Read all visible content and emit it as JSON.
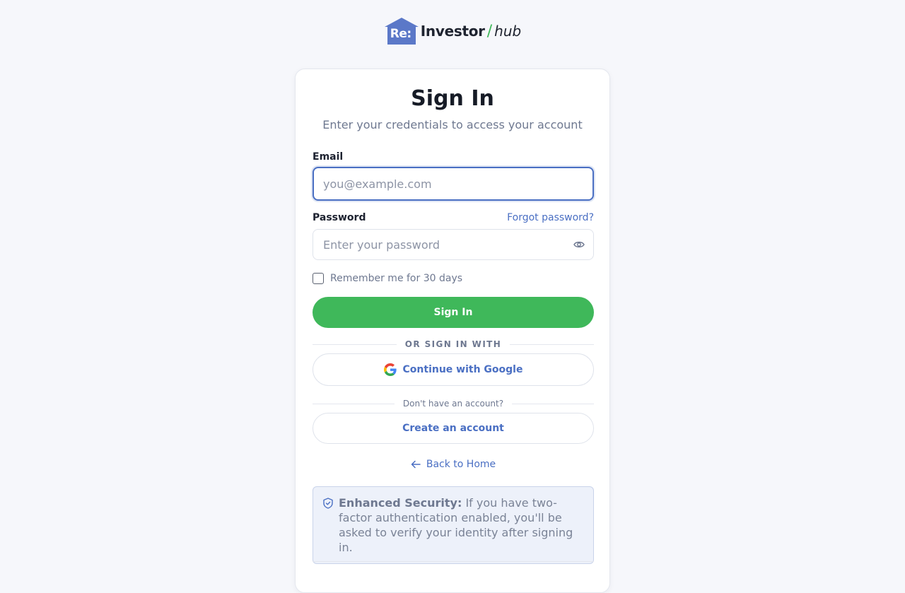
{
  "brand": {
    "mark": "Re:",
    "word": "Investor",
    "slash": "/",
    "suffix": "hub",
    "mark_color": "#5b78c8",
    "accent_color": "#3fb85a"
  },
  "form": {
    "title": "Sign In",
    "subtitle": "Enter your credentials to access your account",
    "email_label": "Email",
    "email_placeholder": "you@example.com",
    "email_value": "",
    "password_label": "Password",
    "forgot_link": "Forgot password?",
    "password_placeholder": "Enter your password",
    "password_value": "",
    "remember_label": "Remember me for 30 days",
    "remember_checked": false,
    "submit_label": "Sign In",
    "submit_color": "#3fb85a"
  },
  "social": {
    "divider_text": "OR SIGN IN WITH",
    "google_label": "Continue with Google"
  },
  "signup": {
    "divider_text": "Don't have an account?",
    "create_label": "Create an account"
  },
  "nav": {
    "back_label": "Back to Home"
  },
  "security": {
    "heading": "Enhanced Security:",
    "body": " If you have two-factor authentication enabled, you'll be asked to verify your identity after signing in."
  },
  "icons": {
    "password_toggle": "eye-icon",
    "google": "google-logo-icon",
    "back": "arrow-left-icon",
    "security": "shield-icon"
  }
}
